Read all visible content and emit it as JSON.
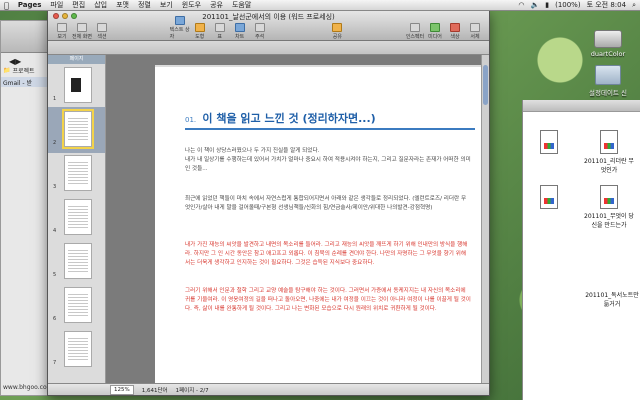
{
  "menubar": {
    "apple": "",
    "items": [
      "Pages",
      "파일",
      "편집",
      "삽입",
      "포맷",
      "정렬",
      "보기",
      "윈도우",
      "공유",
      "도움말"
    ],
    "clock": "토 오전 8:04",
    "battery": "(100%)"
  },
  "browser": {
    "tab1": "프로젝트",
    "tab2": "Gmail - 받",
    "status": "www.bhgoo.com"
  },
  "pages_window": {
    "title": "201101_날선군에서의 이용 (워드 프로세싱)",
    "toolbar": {
      "left": [
        "보기",
        "전체 화면",
        "섹션",
        "텍스트 상자",
        "도형",
        "표",
        "차트",
        "주석",
        "공유",
        "인스펙터",
        "미디어",
        "색상",
        "서체"
      ],
      "center_label": "텍스트 상자"
    },
    "sidebar_header": "페이지",
    "thumb_numbers": [
      "1",
      "2",
      "3",
      "4",
      "5",
      "6",
      "7"
    ],
    "status": {
      "zoom": "125%",
      "words": "1,641단어",
      "pages": "1페이지 - 2/7"
    }
  },
  "document": {
    "heading_num": "01.",
    "heading": "이 책을 읽고 느낀 것 (정리하자면...)",
    "para1": "나는 이 책이 상당스러웠으나 두 가지 진실을 알게 되었다.",
    "para1b": "내가 내 일상기를 수행하는데 있어서 가치가 얼마나 중요시 하여 적용시켜야 하는지, 그리고 질문자라는 존재가 어떠한 의미인 것들...",
    "para2": "최근에 읽었던 책들이 마치 속에서 자연스럽게 통합되어지면서 아래와 같은 생각들로 정리되었다. (엘런트로즈/ 리더란 무엇인가/살아 내게 말을 걸어올때/구본형 선생님책들/신화의 힘/연금술사/제이안/위대한 나의발견-강점혁명)",
    "para3": "내가 가진 재능의 씨앗을 발견하고 내면의 목소리를 들어라. 그리고 재능의 씨앗을 깨뜨게 하기 위해 인내만의 방식을 행해라. 하지만 그 인 시간 동안은 참고 애고프고 외롭다. 이 침묵의 순례를 견뎌야 한다. 나만의 자명하는 그 무엇을 향기 위해서는 더욱게 생각하고 인지하는 것이 필요하다. 그것은 습득된 지식보다 중요하다.",
    "para4": "그러기 위해서 인문과 철학 그리고 교양 예술을 탐구해야 하는 것이다. 그러면서 가증에서 동케지지는 내 자신의 목소리에 귀를 기울여라. 이 영웅여정의 길을 떠나고 돌아오면, 나중에는 내가 여정을 이끄는 것이 아니라 여정이 나를 이끌게 될 것이다. 즉, 삶이 내를 완통하게 될 것이다. 그리고 나는 변화된 모습으로 다시 원래의 위치로 귀환하게 될 것이다."
  },
  "desktop": {
    "hdd_label": "duartColor",
    "folder_label": "설정데이트 신",
    "finder_files": [
      "201101_리더란 무엇인가",
      "201101_무엇이 당신을 만드는가"
    ],
    "finder_bottom": "201101_독서노트만듦거거"
  }
}
